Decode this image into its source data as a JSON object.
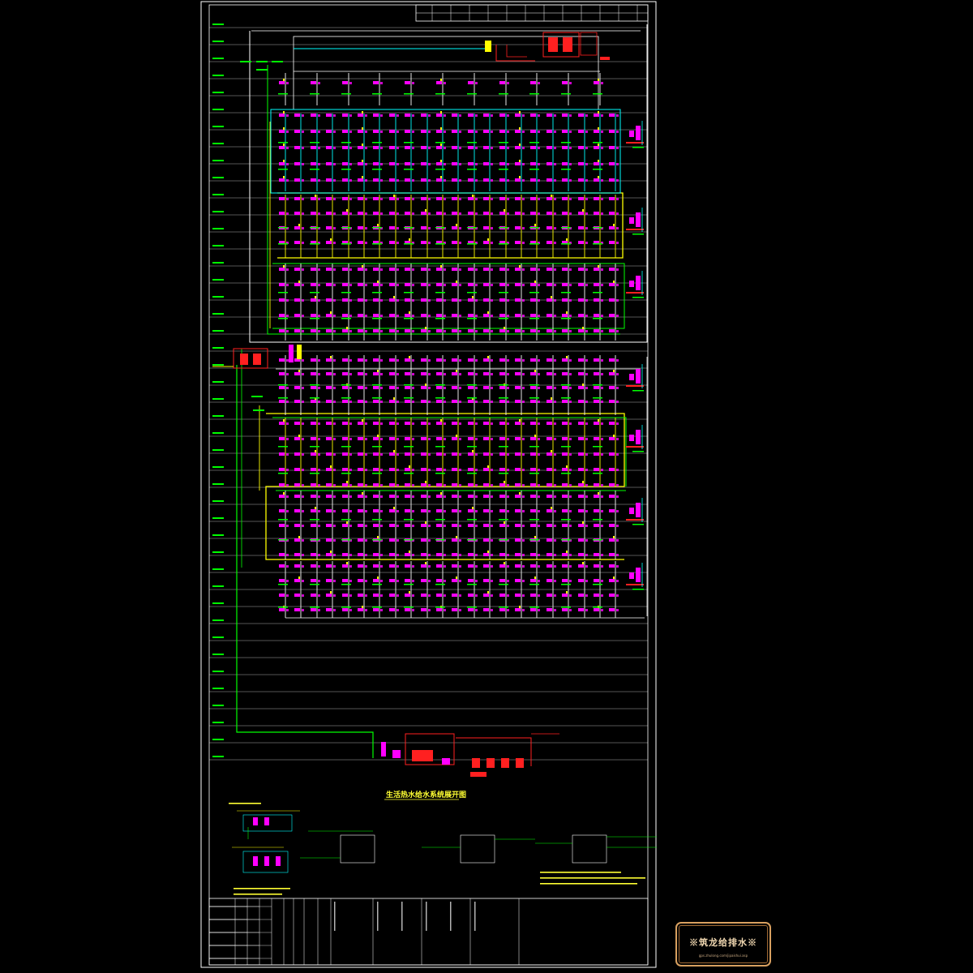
{
  "drawing": {
    "title": "生活热水给水系统展开图",
    "colors": {
      "background": "#000000",
      "frame": "#ffffff",
      "supply_pipe": "#ffff00",
      "cyan_pipe": "#00ffff",
      "green_pipe": "#00ff00",
      "fixture": "#ff00ff",
      "equipment": "#ff2020",
      "text": "#ffff33"
    }
  },
  "stamp": {
    "title": "※筑龙给排水※",
    "url": "gps.zhulong.com/jipaishui.asp"
  }
}
